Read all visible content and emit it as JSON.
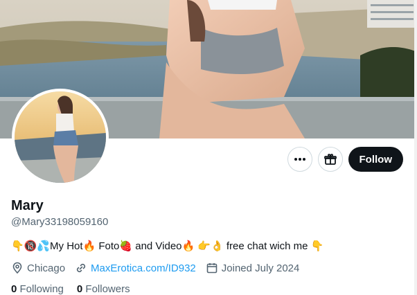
{
  "profile": {
    "display_name": "Mary",
    "handle": "@Mary33198059160",
    "bio": "👇🔞💦My Hot🔥 Foto🍓 and Video🔥 👉👌 free chat wich me 👇",
    "location": "Chicago",
    "website": "MaxErotica.com/ID932",
    "joined": "Joined July 2024",
    "following_count": "0",
    "following_label": "Following",
    "followers_count": "0",
    "followers_label": "Followers"
  },
  "actions": {
    "more_icon": "more-icon",
    "subscribe_icon": "gift-icon",
    "follow_label": "Follow"
  },
  "colors": {
    "accent": "#1d9bf0",
    "follow_bg": "#0f1419",
    "muted_text": "#536471",
    "border": "#cfd9de"
  }
}
